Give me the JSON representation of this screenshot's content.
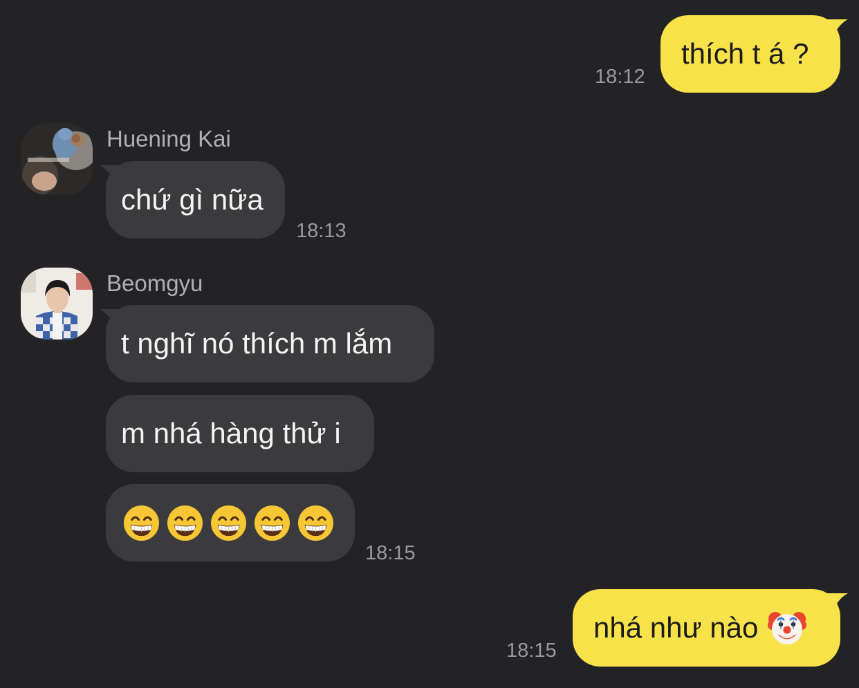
{
  "messages": [
    {
      "id": "m1",
      "sender": "me",
      "text": "thích t á ?",
      "time": "18:12"
    },
    {
      "id": "m2",
      "sender": "Huening Kai",
      "text": "chứ gì nữa",
      "time": "18:13"
    },
    {
      "id": "m3",
      "sender": "Beomgyu",
      "text": "t nghĩ nó thích m lắm"
    },
    {
      "id": "m4",
      "sender": "Beomgyu",
      "text": "m nhá hàng thử i"
    },
    {
      "id": "m5",
      "sender": "Beomgyu",
      "emojis": [
        "grinning-face-with-smiling-eyes",
        "grinning-face-with-smiling-eyes",
        "grinning-face-with-smiling-eyes",
        "grinning-face-with-smiling-eyes",
        "grinning-face-with-smiling-eyes"
      ],
      "time": "18:15"
    },
    {
      "id": "m6",
      "sender": "me",
      "text": "nhá như nào",
      "emoji": "clown-face",
      "time": "18:15"
    }
  ],
  "colors": {
    "background": "#232325",
    "my_bubble": "#f8e24a",
    "their_bubble": "#3b3b3d",
    "timestamp": "#9a9a9c",
    "sender_name": "#b0b0b3"
  }
}
